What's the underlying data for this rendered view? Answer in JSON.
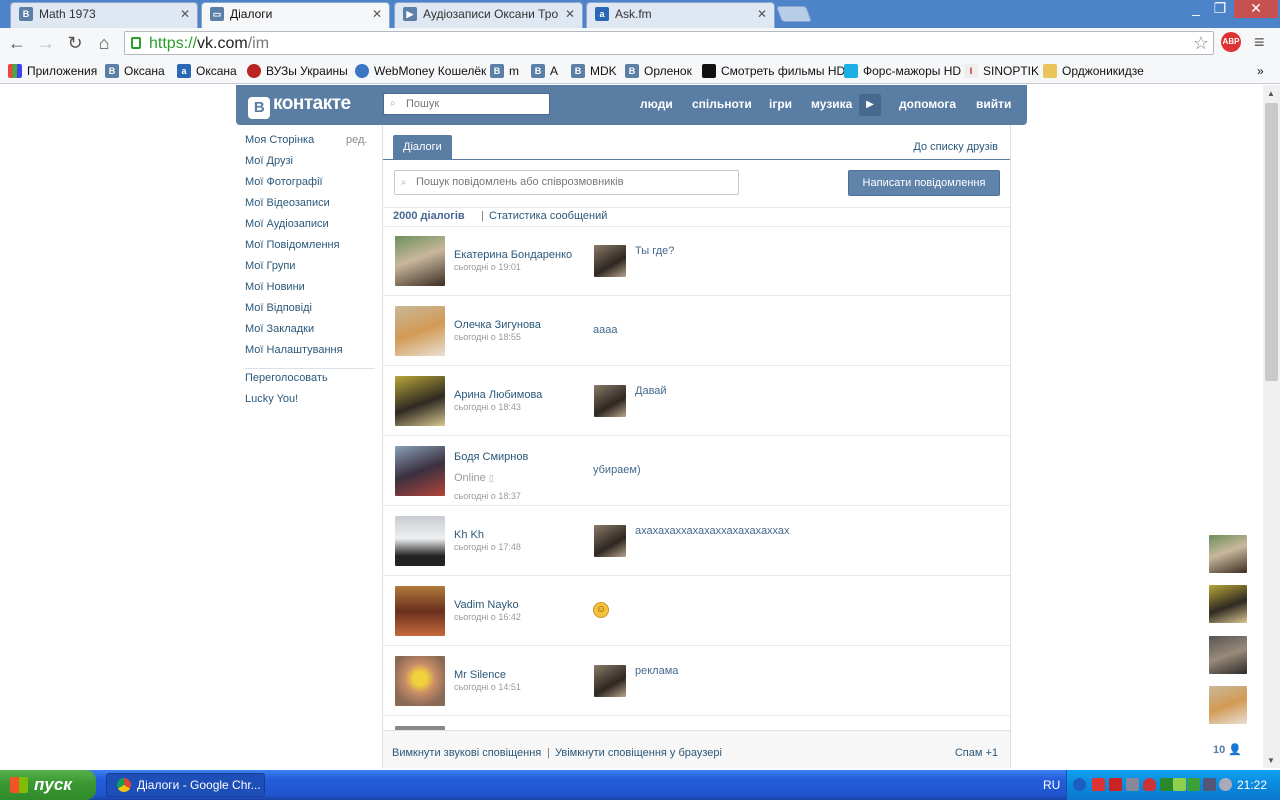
{
  "browser": {
    "tabs": [
      {
        "title": "Math 1973",
        "icon": "vk-icon"
      },
      {
        "title": "Діалоги",
        "icon": "chat-icon"
      },
      {
        "title": "Аудіозаписи Оксани Тро",
        "icon": "play-icon"
      },
      {
        "title": "Ask.fm",
        "icon": "askfm-icon"
      }
    ],
    "url_scheme": "https://",
    "url_host": "vk.com",
    "url_path": "/im",
    "abp_label": "ABP",
    "bookmarks": [
      "Приложения",
      "Оксана",
      "Оксана",
      "ВУЗы Украины",
      "WebMoney Кошелёк",
      "m",
      "A",
      "MDK",
      "Орленок",
      "Смотреть фильмы HD",
      "Форс-мажоры HD",
      "SINOPTIK",
      "Орджоникидзе"
    ],
    "bookmarks_more": "»"
  },
  "vk": {
    "logo_letter": "B",
    "logo_text": "контакте",
    "search_placeholder": "Пошук",
    "nav": [
      "люди",
      "спільноти",
      "ігри",
      "музика",
      "допомога",
      "вийти"
    ]
  },
  "leftmenu": {
    "edit": "ред.",
    "items": [
      "Моя Сторінка",
      "Мої Друзі",
      "Мої Фотографії",
      "Мої Відеозаписи",
      "Мої Аудіозаписи",
      "Мої Повідомлення",
      "Мої Групи",
      "Мої Новини",
      "Мої Відповіді",
      "Мої Закладки",
      "Мої Налаштування"
    ],
    "extra": [
      "Переголосовать",
      "Lucky You!"
    ]
  },
  "im": {
    "tab_label": "Діалоги",
    "to_friends": "До списку друзів",
    "search_placeholder": "Пошук повідомлень або співрозмовників",
    "write_button": "Написати повідомлення",
    "count": "2000 діалогів",
    "stats_link": "Статистика сообщений",
    "dialogs": [
      {
        "name": "Екатерина Бондаренко",
        "date": "сьогодні о 19:01",
        "message": "Ты где?",
        "own": true
      },
      {
        "name": "Олечка Зигунова",
        "date": "сьогодні о 18:55",
        "message": "аааа",
        "own": false
      },
      {
        "name": "Арина Любимова",
        "date": "сьогодні о 18:43",
        "message": "Давай",
        "own": true
      },
      {
        "name": "Бодя Смирнов",
        "status": "Online",
        "date": "сьогодні о 18:37",
        "message": "убираем)",
        "own": false
      },
      {
        "name": "Kh Kh",
        "date": "сьогодні о 17:48",
        "message": "ахахахаххахахаххахахахаххах",
        "own": true
      },
      {
        "name": "Vadim Nayko",
        "date": "сьогодні о 16:42",
        "message": "",
        "own": false
      },
      {
        "name": "Mr Silence",
        "date": "сьогодні о 14:51",
        "message": "реклама",
        "own": true
      }
    ],
    "bottom": {
      "mute_sounds": "Вимкнути звукові сповіщення",
      "enable_browser": "Увімкнути сповіщення у браузері",
      "spam": "Спам +1"
    }
  },
  "side_count": "10",
  "taskbar": {
    "start": "пуск",
    "item": "Діалоги - Google Chr...",
    "lang": "RU",
    "clock": "21:22"
  }
}
